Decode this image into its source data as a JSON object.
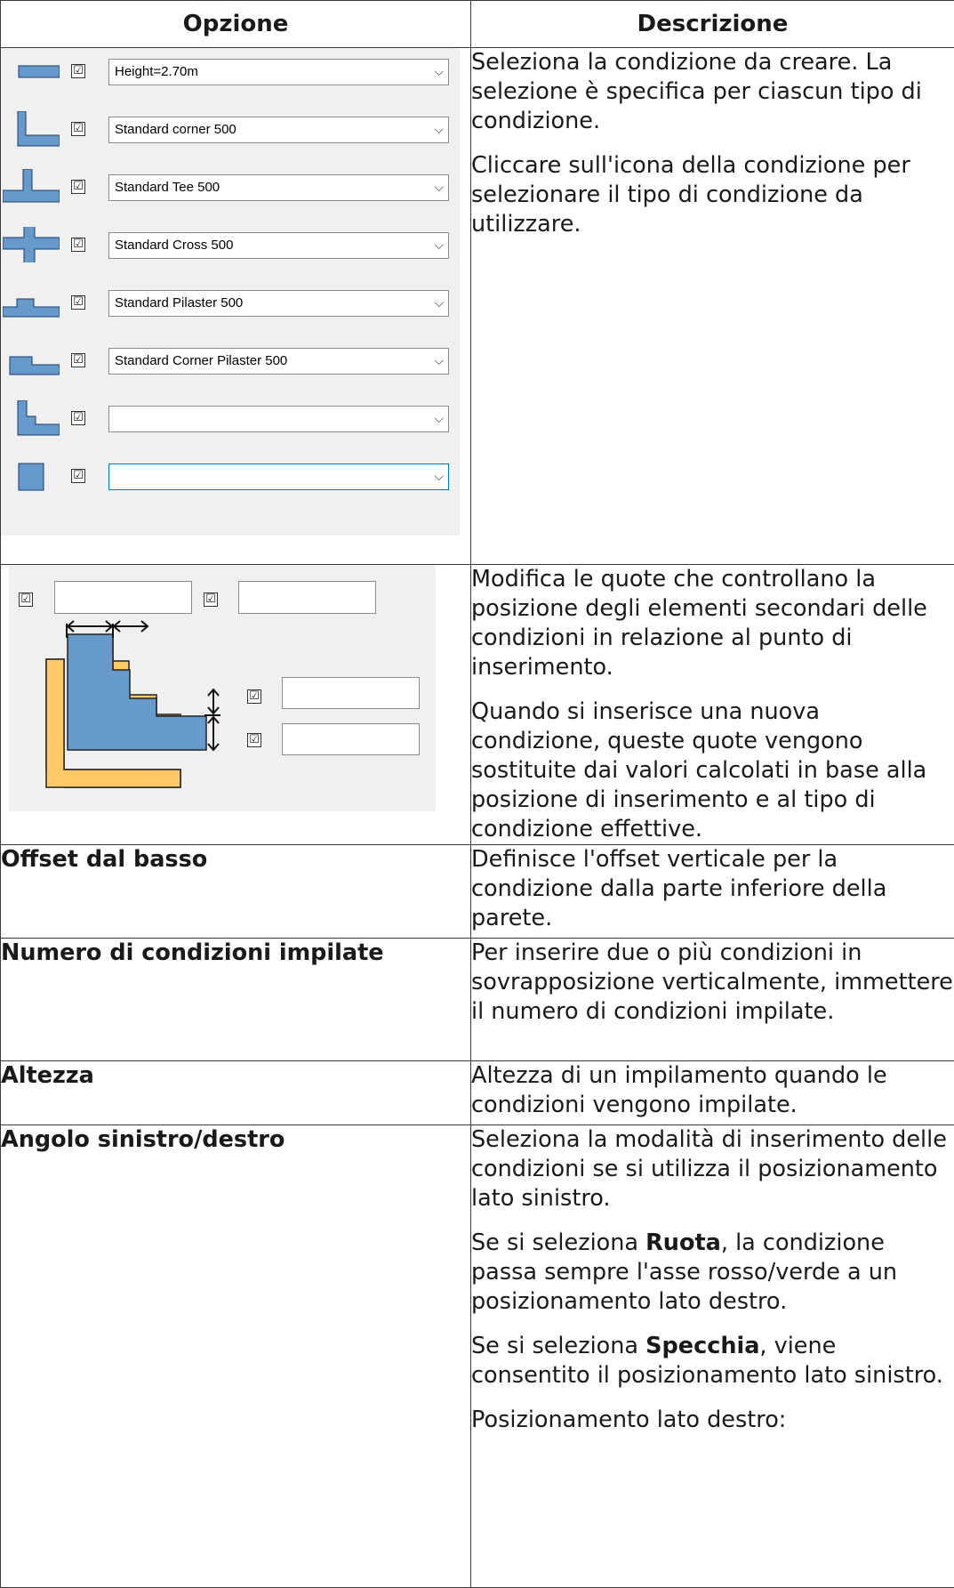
{
  "headers": {
    "option": "Opzione",
    "description": "Descrizione"
  },
  "conditions_panel": {
    "rows": [
      {
        "icon": "wall-segment-icon",
        "checked": true,
        "value": "Height=2.70m"
      },
      {
        "icon": "corner-condition-icon",
        "checked": true,
        "value": "Standard corner 500"
      },
      {
        "icon": "tee-condition-icon",
        "checked": true,
        "value": "Standard Tee 500"
      },
      {
        "icon": "cross-condition-icon",
        "checked": true,
        "value": "Standard Cross 500"
      },
      {
        "icon": "pilaster-condition-icon",
        "checked": true,
        "value": "Standard Pilaster 500"
      },
      {
        "icon": "corner-pilaster-condition-icon",
        "checked": true,
        "value": "Standard Corner Pilaster 500"
      },
      {
        "icon": "corner-condition-alt-icon",
        "checked": true,
        "value": ""
      },
      {
        "icon": "column-condition-icon",
        "checked": true,
        "value": ""
      }
    ],
    "checkmark": "☑",
    "dropdown_arrow": "⌵"
  },
  "dimensions_panel": {
    "fields": [
      {
        "checked": true,
        "value": ""
      },
      {
        "checked": true,
        "value": ""
      },
      {
        "checked": true,
        "value": ""
      },
      {
        "checked": true,
        "value": ""
      }
    ],
    "colors": {
      "primary": "#6699cc",
      "secondary": "#ffc966"
    }
  },
  "rows": [
    {
      "paragraphs": [
        "Seleziona la condizione da creare. La selezione è specifica per ciascun tipo di condizione.",
        "Cliccare sull'icona della condizione per selezionare il tipo di condizione da utilizzare."
      ]
    },
    {
      "paragraphs": [
        "Modifica le quote che controllano la posizione degli elementi secondari delle condizioni in relazione al punto di inserimento.",
        "Quando si inserisce una nuova condizione, queste quote vengono sostituite dai valori calcolati in base alla posizione di inserimento e al tipo di condizione effettive."
      ]
    },
    {
      "option": "Offset dal basso",
      "paragraphs": [
        "Definisce l'offset verticale per la condizione dalla parte inferiore della parete."
      ]
    },
    {
      "option": "Numero di condizioni impilate",
      "paragraphs": [
        "Per inserire due o più condizioni in sovrapposizione verticalmente, immettere il numero di condizioni impilate."
      ]
    },
    {
      "option": "Altezza",
      "paragraphs": [
        "Altezza di un impilamento quando le condizioni vengono impilate."
      ]
    },
    {
      "option": "Angolo sinistro/destro",
      "p1": "Seleziona la modalità di inserimento delle condizioni se si utilizza il posizionamento lato sinistro.",
      "p2_pre": "Se si seleziona ",
      "p2_bold": "Ruota",
      "p2_post": ", la condizione passa sempre l'asse rosso/verde a un posizionamento lato destro.",
      "p3_pre": "Se si seleziona ",
      "p3_bold": "Specchia",
      "p3_post": ", viene consentito il posizionamento lato sinistro.",
      "p4": "Posizionamento lato destro:"
    }
  ]
}
